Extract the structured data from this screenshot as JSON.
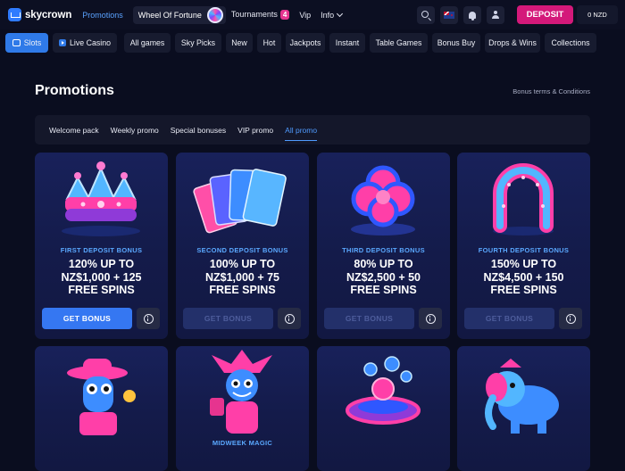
{
  "brand": {
    "name": "skycrown"
  },
  "topnav": {
    "promotions": "Promotions",
    "wheel_of_fortune": "Wheel Of Fortune",
    "tournaments": "Tournaments",
    "tournaments_count": "4",
    "vip": "Vip",
    "info": "Info"
  },
  "header_actions": {
    "deposit": "DEPOSIT",
    "balance": "0 NZD"
  },
  "categories": [
    {
      "label": "Slots",
      "icon": "slots-icon"
    },
    {
      "label": "Live Casino",
      "icon": "play-icon"
    },
    {
      "label": "All games"
    },
    {
      "label": "Sky Picks"
    },
    {
      "label": "New"
    },
    {
      "label": "Hot"
    },
    {
      "label": "Jackpots"
    },
    {
      "label": "Instant"
    },
    {
      "label": "Table Games"
    },
    {
      "label": "Bonus Buy"
    },
    {
      "label": "Drops & Wins"
    },
    {
      "label": "Collections"
    }
  ],
  "page": {
    "title": "Promotions",
    "terms_link": "Bonus terms & Conditions"
  },
  "promo_tabs": [
    {
      "label": "Welcome pack"
    },
    {
      "label": "Weekly promo"
    },
    {
      "label": "Special bonuses"
    },
    {
      "label": "VIP promo"
    },
    {
      "label": "All promo",
      "active": true
    }
  ],
  "promos": [
    {
      "eyebrow": "FIRST DEPOSIT BONUS",
      "line1": "120% UP TO",
      "line2": "NZ$1,000 + 125",
      "line3": "FREE SPINS",
      "button": "GET BONUS",
      "enabled": true,
      "art": "crown-icon"
    },
    {
      "eyebrow": "SECOND DEPOSIT BONUS",
      "line1": "100% UP TO",
      "line2": "NZ$1,000 + 75",
      "line3": "FREE SPINS",
      "button": "GET BONUS",
      "enabled": false,
      "art": "playing-cards-icon"
    },
    {
      "eyebrow": "THIRD DEPOSIT BONUS",
      "line1": "80% UP TO",
      "line2": "NZ$2,500 + 50",
      "line3": "FREE SPINS",
      "button": "GET BONUS",
      "enabled": false,
      "art": "clover-icon"
    },
    {
      "eyebrow": "FOURTH DEPOSIT BONUS",
      "line1": "150% UP TO",
      "line2": "NZ$4,500 + 150",
      "line3": "FREE SPINS",
      "button": "GET BONUS",
      "enabled": false,
      "art": "horseshoe-icon"
    }
  ],
  "promos_row2": [
    {
      "art": "cowboy-mascot-icon",
      "eyebrow": ""
    },
    {
      "art": "jester-mascot-icon",
      "eyebrow": "MIDWEEK MAGIC"
    },
    {
      "art": "coin-fountain-icon",
      "eyebrow": ""
    },
    {
      "art": "elephant-icon",
      "eyebrow": ""
    }
  ]
}
